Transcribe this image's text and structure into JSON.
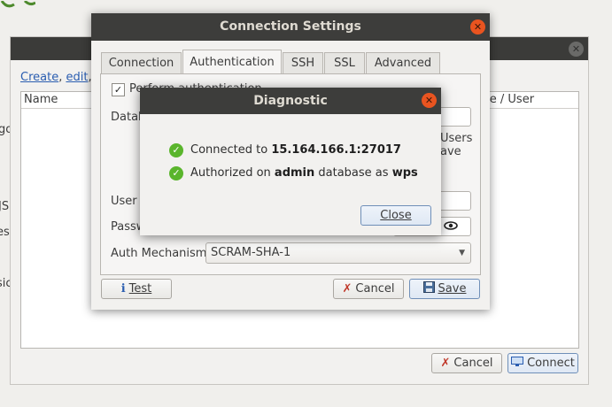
{
  "edge": {
    "top_fragments": [
      "go",
      "JS",
      "es",
      "sic"
    ]
  },
  "bg_window": {
    "links": {
      "create": "Create",
      "edit": "edit"
    },
    "columns": {
      "name": "Name",
      "user": "se / User"
    },
    "cancel_label": "Cancel",
    "connect_label": "Connect"
  },
  "conn_window": {
    "title": "Connection Settings",
    "tabs": [
      "Connection",
      "Authentication",
      "SSH",
      "SSL",
      "Advanced"
    ],
    "active_tab": "Authentication",
    "perform_auth_label": "Perform authentication",
    "perform_auth_checked": true,
    "database_label": "Datab",
    "users_note": [
      "Users",
      "ave"
    ],
    "user_label": "User I",
    "password_label": "Passw",
    "auth_mechanism_label": "Auth Mechanism",
    "auth_mechanism_value": "SCRAM-SHA-1",
    "test_label": "Test",
    "cancel_label": "Cancel",
    "save_label": "Save"
  },
  "diagnostic": {
    "title": "Diagnostic",
    "line1_prefix": "Connected to ",
    "line1_host": "15.164.166.1:27017",
    "line2_prefix": "Authorized on ",
    "line2_db": "admin",
    "line2_mid": " database as ",
    "line2_user": "wps",
    "close_label": "Close"
  },
  "colors": {
    "accent_close": "#e95420",
    "success": "#5ab52c",
    "titlebar": "#3d3d3b"
  },
  "icons": {
    "close": "close-icon",
    "success": "check-circle-icon",
    "test": "info-icon",
    "cancel": "x-icon",
    "save": "floppy-icon",
    "connect": "monitor-icon",
    "eye": "eye-icon"
  }
}
